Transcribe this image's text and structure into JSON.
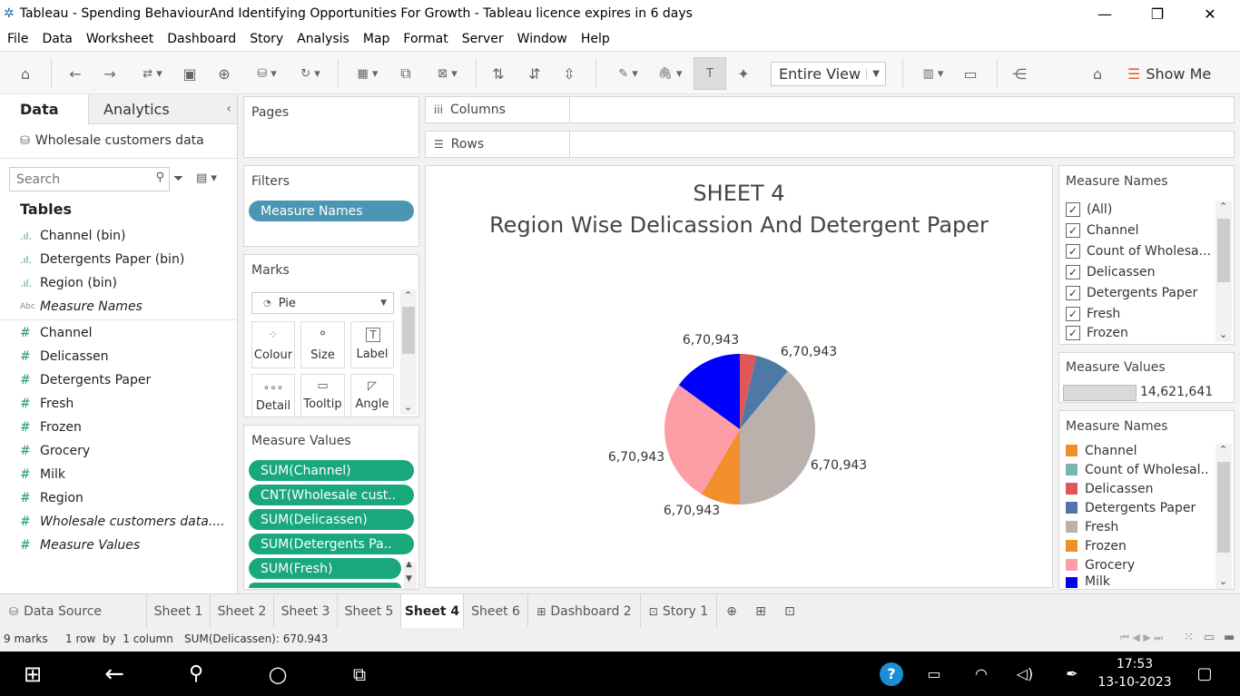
{
  "window": {
    "title": "Tableau - Spending BehaviourAnd Identifying Opportunities For Growth - Tableau licence expires in 6 days"
  },
  "menu": [
    "File",
    "Data",
    "Worksheet",
    "Dashboard",
    "Story",
    "Analysis",
    "Map",
    "Format",
    "Server",
    "Window",
    "Help"
  ],
  "toolbar": {
    "view_select": "Entire View",
    "show_me": "Show Me"
  },
  "datapane": {
    "tab_data": "Data",
    "tab_analytics": "Analytics",
    "datasource": "Wholesale customers data",
    "search_placeholder": "Search",
    "tables_heading": "Tables",
    "dimensions": [
      {
        "label": "Channel (bin)",
        "icon": "bin-icon"
      },
      {
        "label": "Detergents Paper (bin)",
        "icon": "bin-icon"
      },
      {
        "label": "Region (bin)",
        "icon": "bin-icon"
      },
      {
        "label": "Measure Names",
        "icon": "abc-icon"
      }
    ],
    "measures": [
      "Channel",
      "Delicassen",
      "Detergents Paper",
      "Fresh",
      "Frozen",
      "Grocery",
      "Milk",
      "Region",
      "Wholesale customers data....",
      "Measure Values"
    ]
  },
  "shelves": {
    "pages": "Pages",
    "filters": "Filters",
    "filter_pill": "Measure Names",
    "marks": "Marks",
    "mark_type": "Pie",
    "mark_cards": [
      "Colour",
      "Size",
      "Label",
      "Detail",
      "Tooltip",
      "Angle"
    ],
    "measure_values_title": "Measure Values",
    "measure_values_pills": [
      "SUM(Channel)",
      "CNT(Wholesale cust..",
      "SUM(Delicassen)",
      "SUM(Detergents Pa..",
      "SUM(Fresh)"
    ],
    "columns": "Columns",
    "rows": "Rows"
  },
  "chart_data": {
    "type": "pie",
    "title": "SHEET 4",
    "subtitle": "Region Wise Delicassion And Detergent Paper",
    "series": [
      {
        "name": "Delicassen",
        "value": 0.035,
        "label": "6,70,943",
        "color": "#e15759"
      },
      {
        "name": "Detergents Paper",
        "value": 0.075,
        "label": "6,70,943",
        "color": "#4e79a7"
      },
      {
        "name": "Fresh",
        "value": 0.39,
        "label": "6,70,943",
        "color": "#bab0ac"
      },
      {
        "name": "Frozen",
        "value": 0.085,
        "label": "6,70,943",
        "color": "#f28e2b"
      },
      {
        "name": "Grocery",
        "value": 0.265,
        "label": "6,70,943",
        "color": "#ff9da7"
      },
      {
        "name": "Milk",
        "value": 0.15,
        "label": "6,70,943",
        "color": "#0000ff"
      }
    ]
  },
  "filter_card": {
    "title": "Measure Names",
    "items": [
      "(All)",
      "Channel",
      "Count of Wholesa...",
      "Delicassen",
      "Detergents Paper",
      "Fresh",
      "Frozen"
    ]
  },
  "size_legend": {
    "title": "Measure Values",
    "value": "14,621,641"
  },
  "colour_legend": {
    "title": "Measure Names",
    "items": [
      {
        "label": "Channel",
        "color": "#f28e2b"
      },
      {
        "label": "Count of Wholesal..",
        "color": "#76b7b2"
      },
      {
        "label": "Delicassen",
        "color": "#e15759"
      },
      {
        "label": "Detergents Paper",
        "color": "#4e79a7"
      },
      {
        "label": "Fresh",
        "color": "#bab0ac"
      },
      {
        "label": "Frozen",
        "color": "#f28e2b"
      },
      {
        "label": "Grocery",
        "color": "#ff9da7"
      },
      {
        "label": "Milk",
        "color": "#0000ff"
      }
    ]
  },
  "tabs": {
    "datasource": "Data Source",
    "sheets": [
      "Sheet 1",
      "Sheet 2",
      "Sheet 3",
      "Sheet 5",
      "Sheet 4",
      "Sheet 6",
      "Dashboard 2",
      "Story 1"
    ]
  },
  "status": {
    "marks": "9 marks",
    "dims": "1 row  by  1 column",
    "sum": "SUM(Delicassen): 670.943"
  },
  "taskbar": {
    "time": "17:53",
    "date": "13-10-2023"
  }
}
